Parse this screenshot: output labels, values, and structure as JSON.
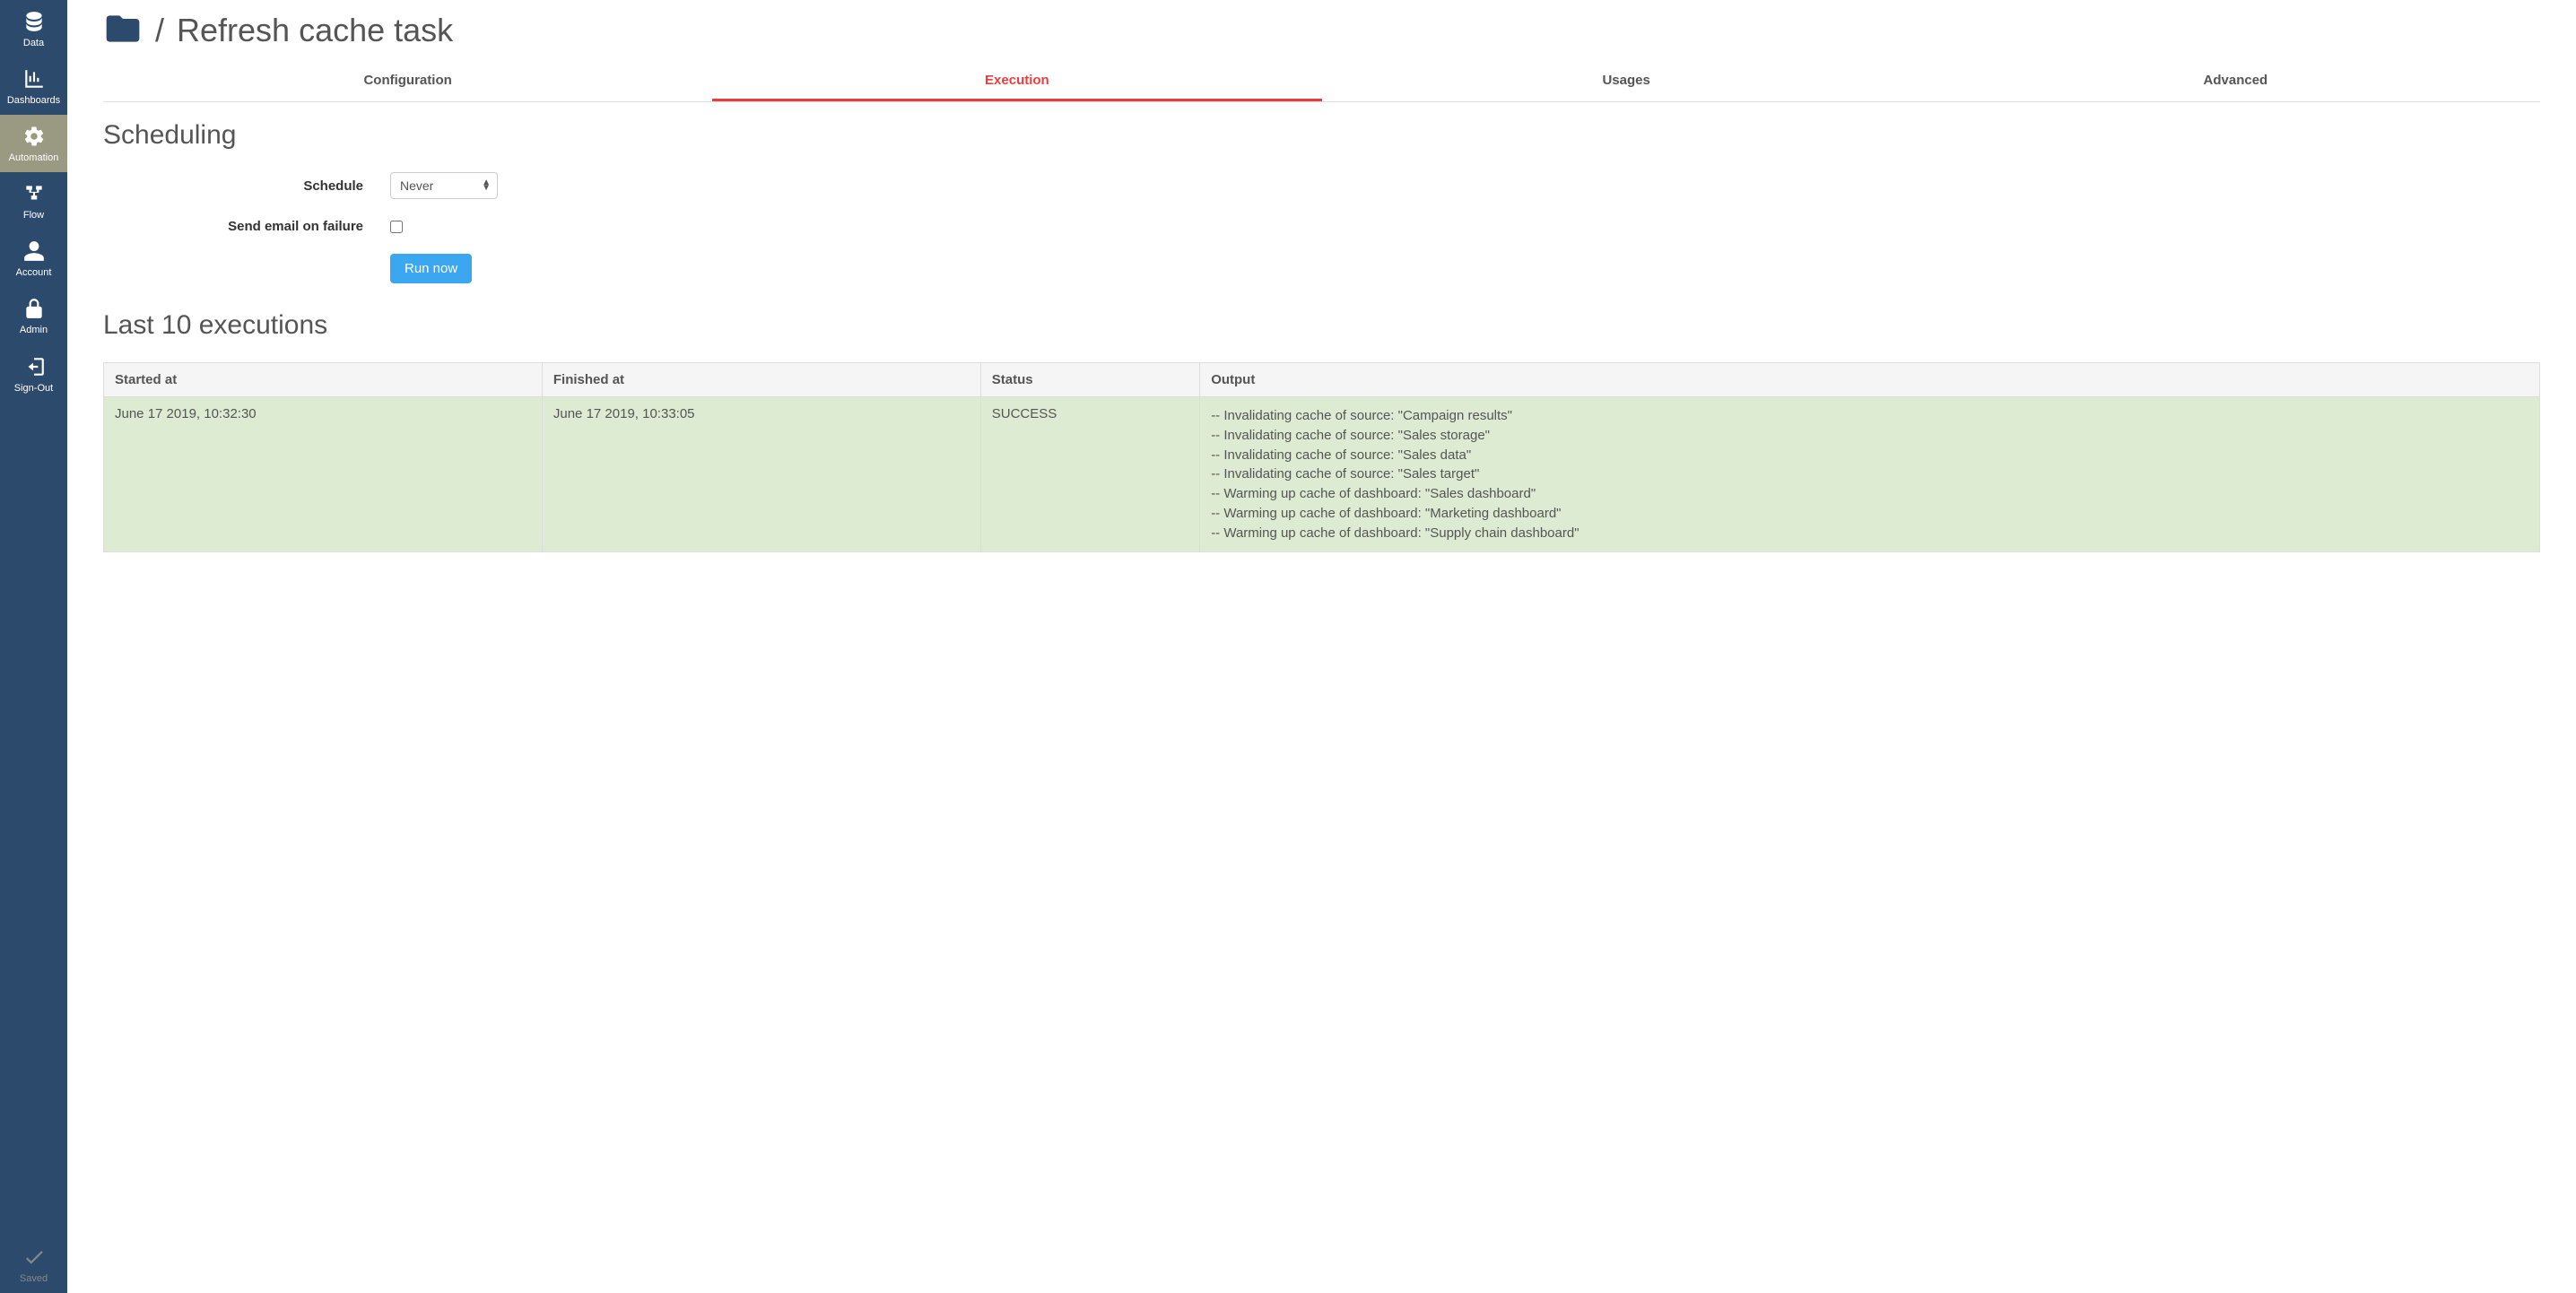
{
  "sidebar": {
    "items": [
      {
        "label": "Data"
      },
      {
        "label": "Dashboards"
      },
      {
        "label": "Automation"
      },
      {
        "label": "Flow"
      },
      {
        "label": "Account"
      },
      {
        "label": "Admin"
      },
      {
        "label": "Sign-Out"
      }
    ],
    "saved_label": "Saved"
  },
  "header": {
    "separator": "/",
    "title": "Refresh cache task"
  },
  "tabs": [
    {
      "label": "Configuration"
    },
    {
      "label": "Execution"
    },
    {
      "label": "Usages"
    },
    {
      "label": "Advanced"
    }
  ],
  "scheduling": {
    "heading": "Scheduling",
    "schedule_label": "Schedule",
    "schedule_value": "Never",
    "email_label": "Send email on failure",
    "run_button": "Run now"
  },
  "executions": {
    "heading": "Last 10 executions",
    "columns": {
      "started": "Started at",
      "finished": "Finished at",
      "status": "Status",
      "output": "Output"
    },
    "rows": [
      {
        "started": "June 17 2019, 10:32:30",
        "finished": "June 17 2019, 10:33:05",
        "status": "SUCCESS",
        "output": [
          "-- Invalidating cache of source: \"Campaign results\"",
          "-- Invalidating cache of source: \"Sales storage\"",
          "-- Invalidating cache of source: \"Sales data\"",
          "-- Invalidating cache of source: \"Sales target\"",
          "-- Warming up cache of dashboard: \"Sales dashboard\"",
          "-- Warming up cache of dashboard: \"Marketing dashboard\"",
          "-- Warming up cache of dashboard: \"Supply chain dashboard\""
        ]
      }
    ]
  }
}
